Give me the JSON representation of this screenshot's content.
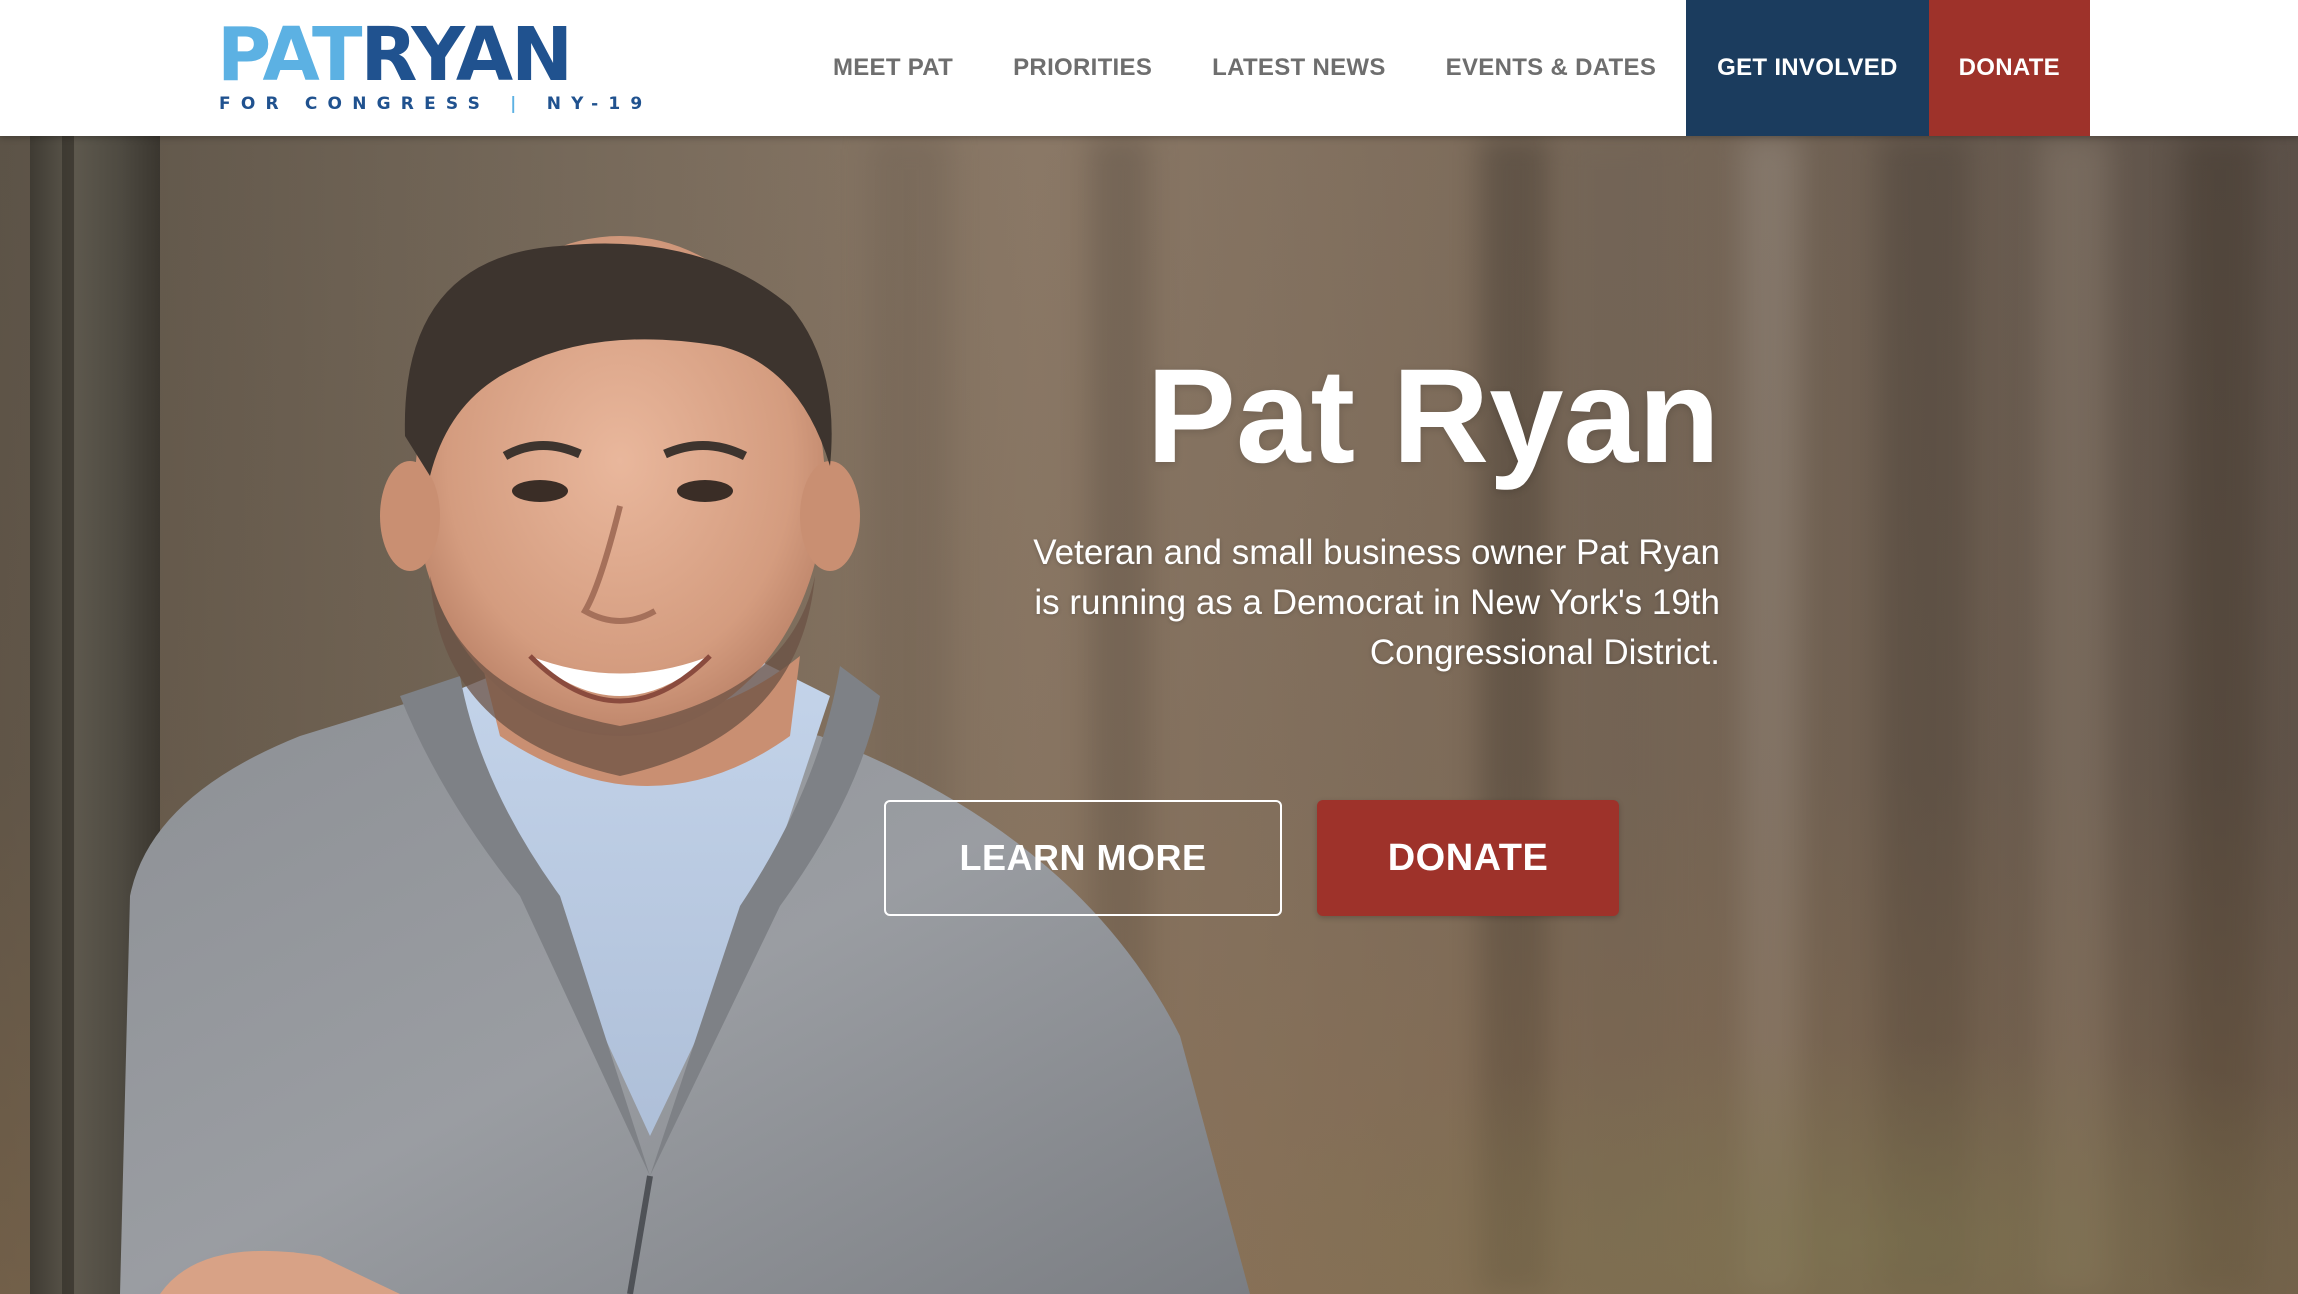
{
  "header": {
    "logo": {
      "first": "PAT",
      "last": "RYAN",
      "tagline_left": "FOR CONGRESS",
      "tagline_sep": "|",
      "tagline_right": "NY-19"
    },
    "nav": [
      {
        "label": "MEET PAT"
      },
      {
        "label": "PRIORITIES"
      },
      {
        "label": "LATEST NEWS"
      },
      {
        "label": "EVENTS & DATES"
      },
      {
        "label": "GET INVOLVED"
      },
      {
        "label": "DONATE"
      }
    ]
  },
  "hero": {
    "title": "Pat Ryan",
    "subtitle": "Veteran and small business owner Pat Ryan is running as a Democrat in New York's 19th Congressional District.",
    "learn_more_label": "LEARN MORE",
    "donate_label": "DONATE"
  },
  "colors": {
    "logo_light_blue": "#5cb1e3",
    "logo_dark_blue": "#20528f",
    "nav_text": "#6e6e6e",
    "get_involved_bg": "#1b3c5e",
    "donate_bg": "#9e322a",
    "hero_text": "#ffffff"
  },
  "icons": {
    "hero_image": "portrait-photo"
  }
}
